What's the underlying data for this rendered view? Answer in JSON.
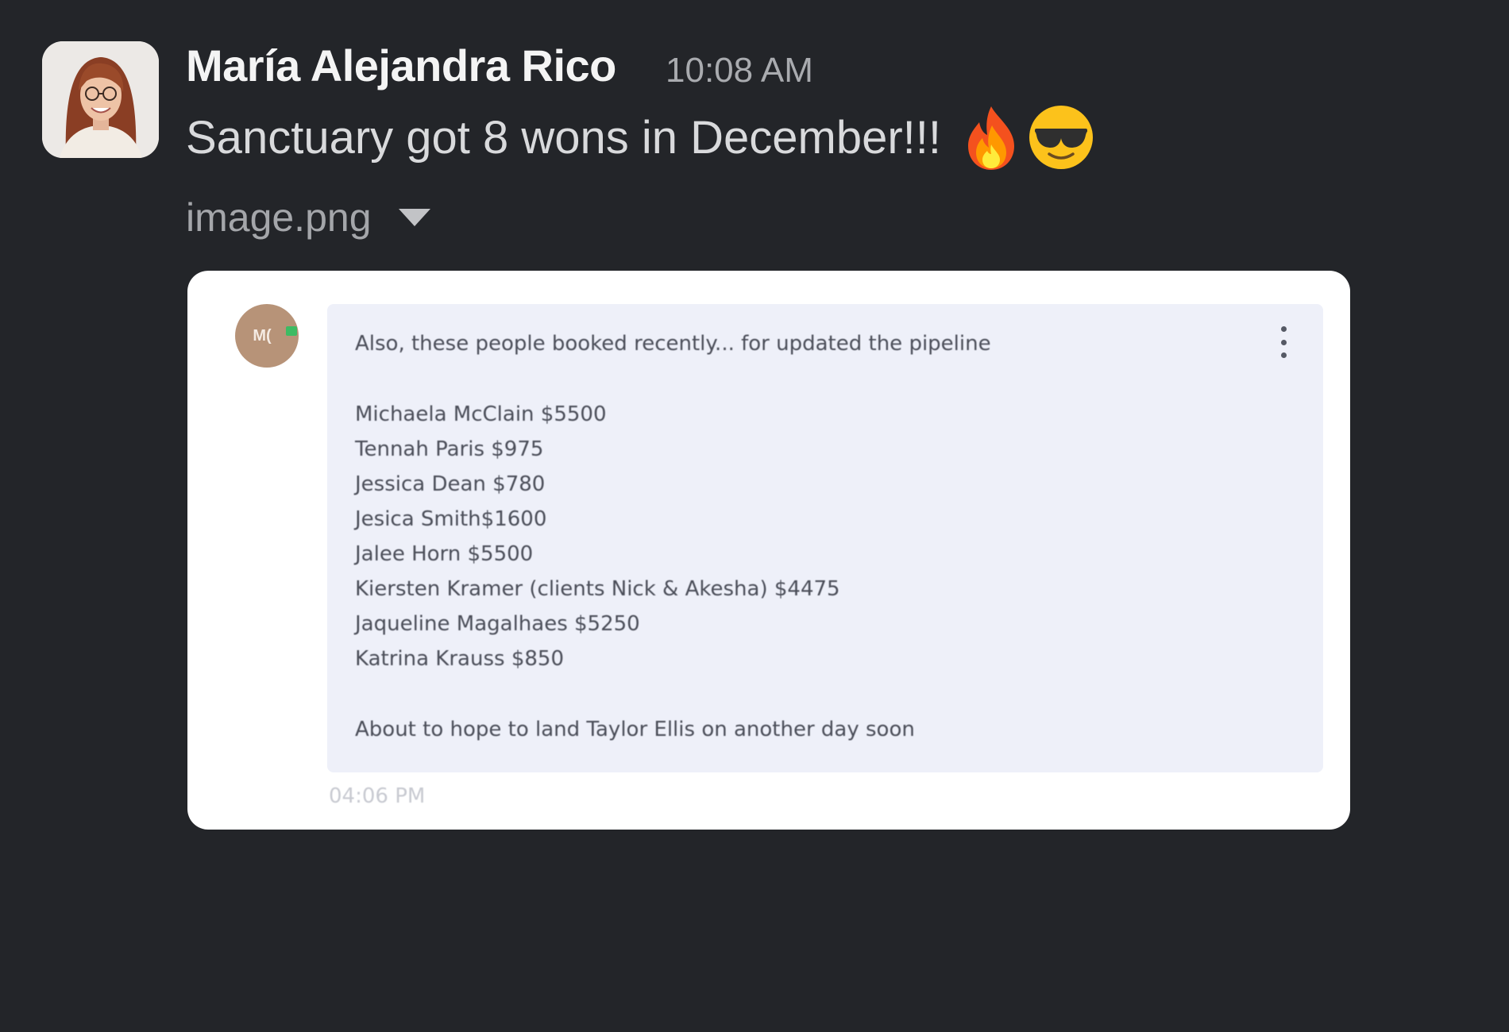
{
  "message": {
    "sender": "María Alejandra Rico",
    "time": "10:08 AM",
    "text": "Sanctuary got 8 wons in December!!!",
    "emojis": [
      "fire-emoji",
      "sunglasses-emoji"
    ]
  },
  "attachment": {
    "filename": "image.png"
  },
  "screenshot": {
    "avatar_initials": "M(",
    "intro": "Also, these people booked recently... for updated the pipeline",
    "bookings": [
      "Michaela McClain $5500",
      "Tennah Paris $975",
      "Jessica Dean $780",
      "Jesica Smith$1600",
      "Jalee Horn $5500",
      "Kiersten Kramer (clients Nick & Akesha) $4475",
      "Jaqueline Magalhaes $5250",
      "Katrina Krauss $850"
    ],
    "outro": "About to hope to land Taylor Ellis on another day soon",
    "time": "04:06 PM"
  },
  "colors": {
    "background": "#232529",
    "bubble": "#eef0f9",
    "inner_avatar": "#b79378",
    "status": "#3dbb63"
  }
}
